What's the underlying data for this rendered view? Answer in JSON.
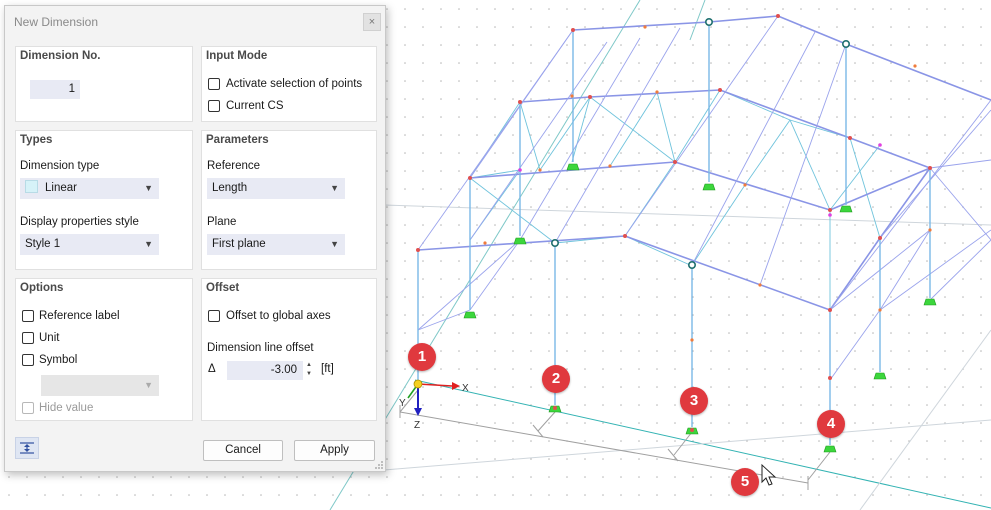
{
  "dialog": {
    "title": "New Dimension",
    "close_glyph": "×",
    "dimension_no": {
      "title": "Dimension No.",
      "value": "1"
    },
    "input_mode": {
      "title": "Input Mode",
      "activate_selection": "Activate selection of points",
      "current_cs": "Current CS"
    },
    "types": {
      "title": "Types",
      "dimension_type_label": "Dimension type",
      "dimension_type_value": "Linear",
      "display_style_label": "Display properties style",
      "display_style_value": "Style 1"
    },
    "parameters": {
      "title": "Parameters",
      "reference_label": "Reference",
      "reference_value": "Length",
      "plane_label": "Plane",
      "plane_value": "First plane"
    },
    "options": {
      "title": "Options",
      "reference_label": "Reference label",
      "unit": "Unit",
      "symbol": "Symbol",
      "hide_value": "Hide value"
    },
    "offset": {
      "title": "Offset",
      "offset_global": "Offset to global axes",
      "line_offset_label": "Dimension line offset",
      "delta_symbol": "Δ",
      "line_offset_value": "-3.00",
      "unit": "[ft]"
    },
    "buttons": {
      "cancel": "Cancel",
      "apply": "Apply"
    }
  },
  "viewport": {
    "axis_labels": {
      "x": "X",
      "y": "Y",
      "z": "Z"
    },
    "badges": [
      "1",
      "2",
      "3",
      "4",
      "5"
    ],
    "colors": {
      "member": "#8a95e6",
      "bracing": "#6fc3dc",
      "column": "#7ab8e6",
      "support": "#3cd63c",
      "node": "#e05050",
      "badge": "#e0393e",
      "global_line": "#33b3b3",
      "dimension_line": "#a0a0a0"
    }
  }
}
